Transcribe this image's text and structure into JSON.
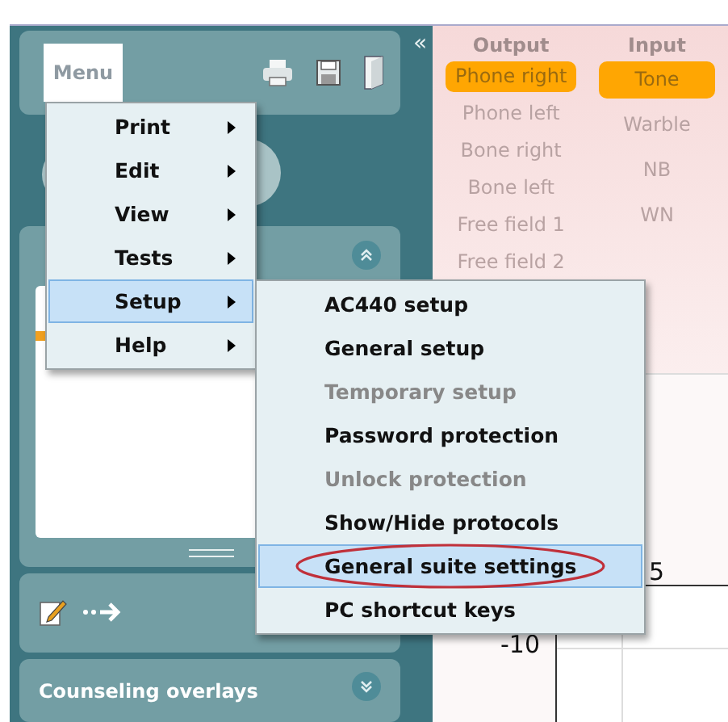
{
  "toolbar": {
    "menu_button": "Menu",
    "collapse": "«"
  },
  "output": {
    "heading": "Output",
    "items": [
      {
        "label": "Phone right",
        "selected": true
      },
      {
        "label": "Phone left",
        "selected": false
      },
      {
        "label": "Bone right",
        "selected": false
      },
      {
        "label": "Bone left",
        "selected": false
      },
      {
        "label": "Free field 1",
        "selected": false
      },
      {
        "label": "Free field 2",
        "selected": false
      }
    ]
  },
  "input": {
    "heading": "Input",
    "items": [
      {
        "label": "Tone",
        "selected": true
      },
      {
        "label": "Warble",
        "selected": false
      },
      {
        "label": "NB",
        "selected": false
      },
      {
        "label": "WN",
        "selected": false
      }
    ]
  },
  "main_menu": {
    "items": [
      {
        "label": "Print",
        "selected": false,
        "has_submenu": true
      },
      {
        "label": "Edit",
        "selected": false,
        "has_submenu": true
      },
      {
        "label": "View",
        "selected": false,
        "has_submenu": true
      },
      {
        "label": "Tests",
        "selected": false,
        "has_submenu": true
      },
      {
        "label": "Setup",
        "selected": true,
        "has_submenu": true
      },
      {
        "label": "Help",
        "selected": false,
        "has_submenu": true
      }
    ]
  },
  "setup_menu": {
    "items": [
      {
        "label": "AC440 setup",
        "selected": false,
        "disabled": false,
        "circled": false
      },
      {
        "label": "General setup",
        "selected": false,
        "disabled": false,
        "circled": false
      },
      {
        "label": "Temporary setup",
        "selected": false,
        "disabled": true,
        "circled": false
      },
      {
        "label": "Password protection",
        "selected": false,
        "disabled": false,
        "circled": false
      },
      {
        "label": "Unlock protection",
        "selected": false,
        "disabled": true,
        "circled": false
      },
      {
        "label": "Show/Hide protocols",
        "selected": false,
        "disabled": false,
        "circled": false
      },
      {
        "label": "General suite settings",
        "selected": true,
        "disabled": false,
        "circled": true
      },
      {
        "label": "PC shortcut keys",
        "selected": false,
        "disabled": false,
        "circled": false
      }
    ]
  },
  "graph": {
    "tick_labels": [
      "5",
      "-10"
    ]
  },
  "counseling": {
    "title": "Counseling overlays"
  }
}
